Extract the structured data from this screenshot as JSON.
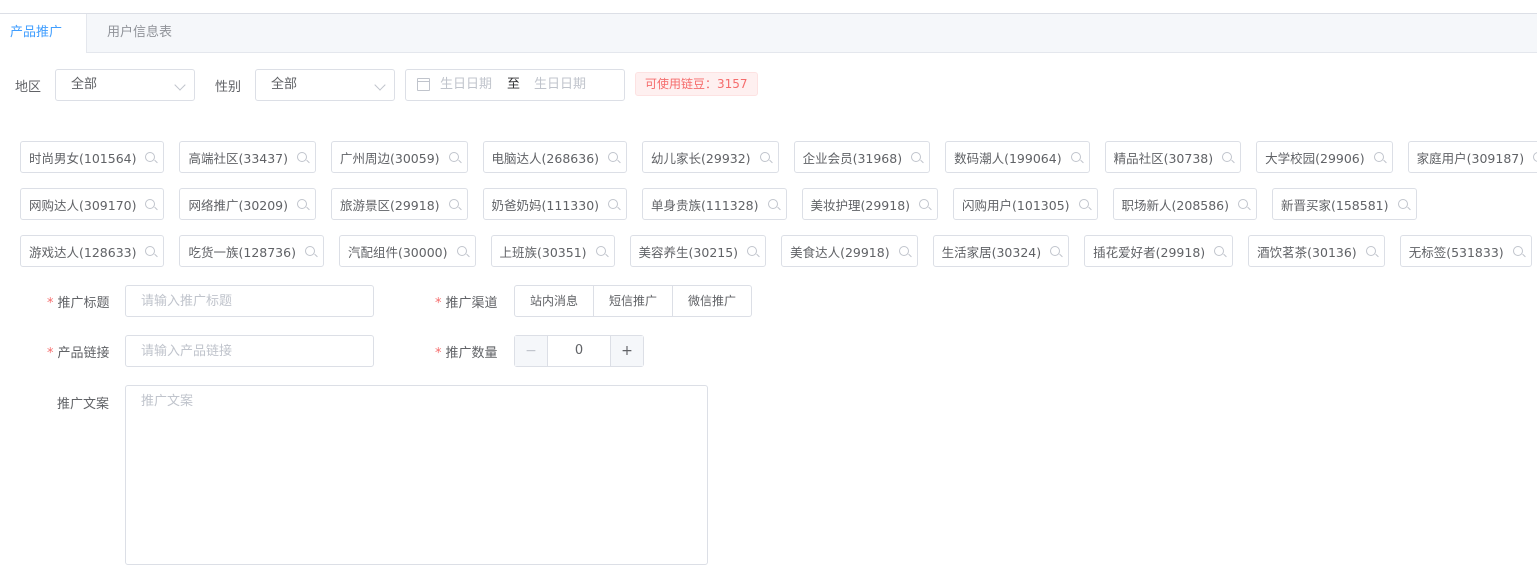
{
  "tabs": [
    {
      "label": "产品推广",
      "active": true
    },
    {
      "label": "用户信息表",
      "active": false
    }
  ],
  "filters": {
    "region_label": "地区",
    "region_value": "全部",
    "gender_label": "性别",
    "gender_value": "全部",
    "date_start_placeholder": "生日日期",
    "date_separator": "至",
    "date_end_placeholder": "生日日期",
    "beans_text": "可使用链豆：3157"
  },
  "tag_rows": [
    [
      "时尚男女(101564)",
      "高端社区(33437)",
      "广州周边(30059)",
      "电脑达人(268636)",
      "幼儿家长(29932)",
      "企业会员(31968)",
      "数码潮人(199064)",
      "精品社区(30738)",
      "大学校园(29906)",
      "家庭用户(309187)"
    ],
    [
      "网购达人(309170)",
      "网络推广(30209)",
      "旅游景区(29918)",
      "奶爸奶妈(111330)",
      "单身贵族(111328)",
      "美妆护理(29918)",
      "闪购用户(101305)",
      "职场新人(208586)",
      "新晋买家(158581)"
    ],
    [
      "游戏达人(128633)",
      "吃货一族(128736)",
      "汽配组件(30000)",
      "上班族(30351)",
      "美容养生(30215)",
      "美食达人(29918)",
      "生活家居(30324)",
      "插花爱好者(29918)",
      "酒饮茗茶(30136)",
      "无标签(531833)"
    ]
  ],
  "form": {
    "required_mark": "*",
    "title_label": "推广标题",
    "title_placeholder": "请输入推广标题",
    "channel_label": "推广渠道",
    "channels": [
      "站内消息",
      "短信推广",
      "微信推广"
    ],
    "link_label": "产品链接",
    "link_placeholder": "请输入产品链接",
    "quantity_label": "推广数量",
    "quantity_minus": "−",
    "quantity_value": "0",
    "quantity_plus": "+",
    "copy_label": "推广文案",
    "copy_placeholder": "推广文案"
  }
}
